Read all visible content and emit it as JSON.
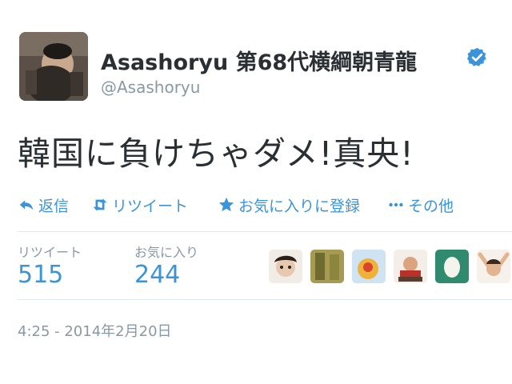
{
  "user": {
    "display_name": "Asashoryu 第68代横綱朝青龍",
    "username": "@Asashoryu"
  },
  "tweet": {
    "text": "韓国に負けちゃダメ!真央!"
  },
  "actions": [
    {
      "label": "返信",
      "icon": "reply-icon"
    },
    {
      "label": "リツイート",
      "icon": "retweet-icon"
    },
    {
      "label": "お気に入りに登録",
      "icon": "star-icon"
    },
    {
      "label": "その他",
      "icon": "more-icon"
    }
  ],
  "stats": {
    "retweets_label": "リツイート",
    "retweets": "515",
    "favorites_label": "お気に入り",
    "favorites": "244"
  },
  "timestamp": "4:25 - 2014年2月20日",
  "colors": {
    "link_blue": "#3b94d9",
    "muted_gray": "#8899a6",
    "text": "#292f33",
    "divider": "#e1e8ed"
  }
}
